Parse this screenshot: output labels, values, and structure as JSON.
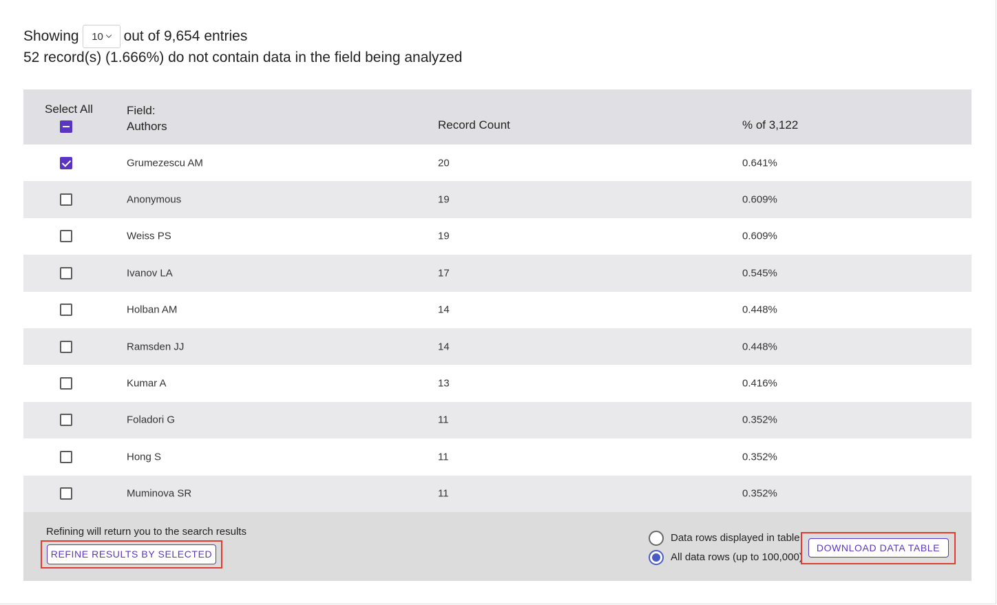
{
  "summary": {
    "showing_label": "Showing",
    "page_size": "10",
    "out_of_label": "out of 9,654 entries",
    "missing_text": "52 record(s) (1.666%) do not contain data in the field being analyzed"
  },
  "table": {
    "headers": {
      "select_all": "Select All",
      "field_label": "Field:",
      "field_name": "Authors",
      "record_count": "Record Count",
      "percent": "% of 3,122"
    },
    "rows": [
      {
        "name": "Grumezescu AM",
        "count": "20",
        "pct": "0.641%",
        "checked": true
      },
      {
        "name": "Anonymous",
        "count": "19",
        "pct": "0.609%",
        "checked": false
      },
      {
        "name": "Weiss PS",
        "count": "19",
        "pct": "0.609%",
        "checked": false
      },
      {
        "name": "Ivanov LA",
        "count": "17",
        "pct": "0.545%",
        "checked": false
      },
      {
        "name": "Holban AM",
        "count": "14",
        "pct": "0.448%",
        "checked": false
      },
      {
        "name": "Ramsden JJ",
        "count": "14",
        "pct": "0.448%",
        "checked": false
      },
      {
        "name": "Kumar A",
        "count": "13",
        "pct": "0.416%",
        "checked": false
      },
      {
        "name": "Foladori G",
        "count": "11",
        "pct": "0.352%",
        "checked": false
      },
      {
        "name": "Hong S",
        "count": "11",
        "pct": "0.352%",
        "checked": false
      },
      {
        "name": "Muminova SR",
        "count": "11",
        "pct": "0.352%",
        "checked": false
      }
    ]
  },
  "footer": {
    "refine_note": "Refining will return you to the search results",
    "refine_button": "REFINE RESULTS BY SELECTED",
    "radio_displayed": "Data rows displayed in table",
    "radio_all": "All data rows (up to 100,000)",
    "radio_selected": "all",
    "download_button": "DOWNLOAD DATA TABLE"
  },
  "colors": {
    "accent": "#5a35c2",
    "highlight_border": "#e03c31",
    "header_bg": "#e0e0e4",
    "alt_row_bg": "#e9e9ec"
  },
  "icons": [
    "chevron-down-icon",
    "checkbox-indeterminate-icon",
    "checkbox-checked-icon",
    "checkbox-empty-icon",
    "radio-icon"
  ]
}
